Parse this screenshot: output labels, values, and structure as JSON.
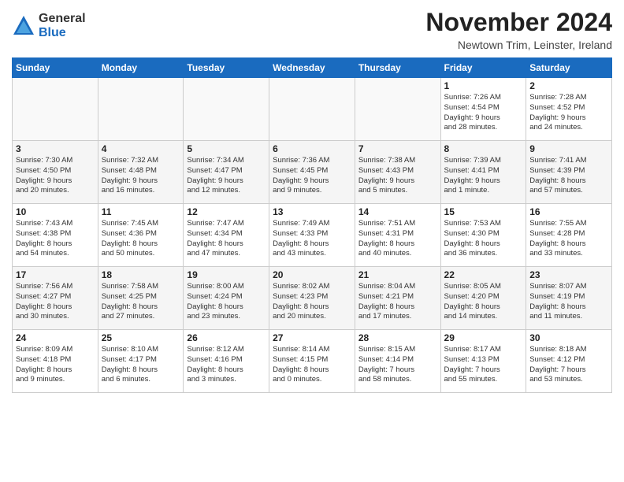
{
  "logo": {
    "general": "General",
    "blue": "Blue"
  },
  "title": "November 2024",
  "location": "Newtown Trim, Leinster, Ireland",
  "days_of_week": [
    "Sunday",
    "Monday",
    "Tuesday",
    "Wednesday",
    "Thursday",
    "Friday",
    "Saturday"
  ],
  "weeks": [
    {
      "days": [
        {
          "num": "",
          "info": "",
          "empty": true
        },
        {
          "num": "",
          "info": "",
          "empty": true
        },
        {
          "num": "",
          "info": "",
          "empty": true
        },
        {
          "num": "",
          "info": "",
          "empty": true
        },
        {
          "num": "",
          "info": "",
          "empty": true
        },
        {
          "num": "1",
          "info": "Sunrise: 7:26 AM\nSunset: 4:54 PM\nDaylight: 9 hours\nand 28 minutes."
        },
        {
          "num": "2",
          "info": "Sunrise: 7:28 AM\nSunset: 4:52 PM\nDaylight: 9 hours\nand 24 minutes."
        }
      ]
    },
    {
      "days": [
        {
          "num": "3",
          "info": "Sunrise: 7:30 AM\nSunset: 4:50 PM\nDaylight: 9 hours\nand 20 minutes."
        },
        {
          "num": "4",
          "info": "Sunrise: 7:32 AM\nSunset: 4:48 PM\nDaylight: 9 hours\nand 16 minutes."
        },
        {
          "num": "5",
          "info": "Sunrise: 7:34 AM\nSunset: 4:47 PM\nDaylight: 9 hours\nand 12 minutes."
        },
        {
          "num": "6",
          "info": "Sunrise: 7:36 AM\nSunset: 4:45 PM\nDaylight: 9 hours\nand 9 minutes."
        },
        {
          "num": "7",
          "info": "Sunrise: 7:38 AM\nSunset: 4:43 PM\nDaylight: 9 hours\nand 5 minutes."
        },
        {
          "num": "8",
          "info": "Sunrise: 7:39 AM\nSunset: 4:41 PM\nDaylight: 9 hours\nand 1 minute."
        },
        {
          "num": "9",
          "info": "Sunrise: 7:41 AM\nSunset: 4:39 PM\nDaylight: 8 hours\nand 57 minutes."
        }
      ]
    },
    {
      "days": [
        {
          "num": "10",
          "info": "Sunrise: 7:43 AM\nSunset: 4:38 PM\nDaylight: 8 hours\nand 54 minutes."
        },
        {
          "num": "11",
          "info": "Sunrise: 7:45 AM\nSunset: 4:36 PM\nDaylight: 8 hours\nand 50 minutes."
        },
        {
          "num": "12",
          "info": "Sunrise: 7:47 AM\nSunset: 4:34 PM\nDaylight: 8 hours\nand 47 minutes."
        },
        {
          "num": "13",
          "info": "Sunrise: 7:49 AM\nSunset: 4:33 PM\nDaylight: 8 hours\nand 43 minutes."
        },
        {
          "num": "14",
          "info": "Sunrise: 7:51 AM\nSunset: 4:31 PM\nDaylight: 8 hours\nand 40 minutes."
        },
        {
          "num": "15",
          "info": "Sunrise: 7:53 AM\nSunset: 4:30 PM\nDaylight: 8 hours\nand 36 minutes."
        },
        {
          "num": "16",
          "info": "Sunrise: 7:55 AM\nSunset: 4:28 PM\nDaylight: 8 hours\nand 33 minutes."
        }
      ]
    },
    {
      "days": [
        {
          "num": "17",
          "info": "Sunrise: 7:56 AM\nSunset: 4:27 PM\nDaylight: 8 hours\nand 30 minutes."
        },
        {
          "num": "18",
          "info": "Sunrise: 7:58 AM\nSunset: 4:25 PM\nDaylight: 8 hours\nand 27 minutes."
        },
        {
          "num": "19",
          "info": "Sunrise: 8:00 AM\nSunset: 4:24 PM\nDaylight: 8 hours\nand 23 minutes."
        },
        {
          "num": "20",
          "info": "Sunrise: 8:02 AM\nSunset: 4:23 PM\nDaylight: 8 hours\nand 20 minutes."
        },
        {
          "num": "21",
          "info": "Sunrise: 8:04 AM\nSunset: 4:21 PM\nDaylight: 8 hours\nand 17 minutes."
        },
        {
          "num": "22",
          "info": "Sunrise: 8:05 AM\nSunset: 4:20 PM\nDaylight: 8 hours\nand 14 minutes."
        },
        {
          "num": "23",
          "info": "Sunrise: 8:07 AM\nSunset: 4:19 PM\nDaylight: 8 hours\nand 11 minutes."
        }
      ]
    },
    {
      "days": [
        {
          "num": "24",
          "info": "Sunrise: 8:09 AM\nSunset: 4:18 PM\nDaylight: 8 hours\nand 9 minutes."
        },
        {
          "num": "25",
          "info": "Sunrise: 8:10 AM\nSunset: 4:17 PM\nDaylight: 8 hours\nand 6 minutes."
        },
        {
          "num": "26",
          "info": "Sunrise: 8:12 AM\nSunset: 4:16 PM\nDaylight: 8 hours\nand 3 minutes."
        },
        {
          "num": "27",
          "info": "Sunrise: 8:14 AM\nSunset: 4:15 PM\nDaylight: 8 hours\nand 0 minutes."
        },
        {
          "num": "28",
          "info": "Sunrise: 8:15 AM\nSunset: 4:14 PM\nDaylight: 7 hours\nand 58 minutes."
        },
        {
          "num": "29",
          "info": "Sunrise: 8:17 AM\nSunset: 4:13 PM\nDaylight: 7 hours\nand 55 minutes."
        },
        {
          "num": "30",
          "info": "Sunrise: 8:18 AM\nSunset: 4:12 PM\nDaylight: 7 hours\nand 53 minutes."
        }
      ]
    }
  ]
}
